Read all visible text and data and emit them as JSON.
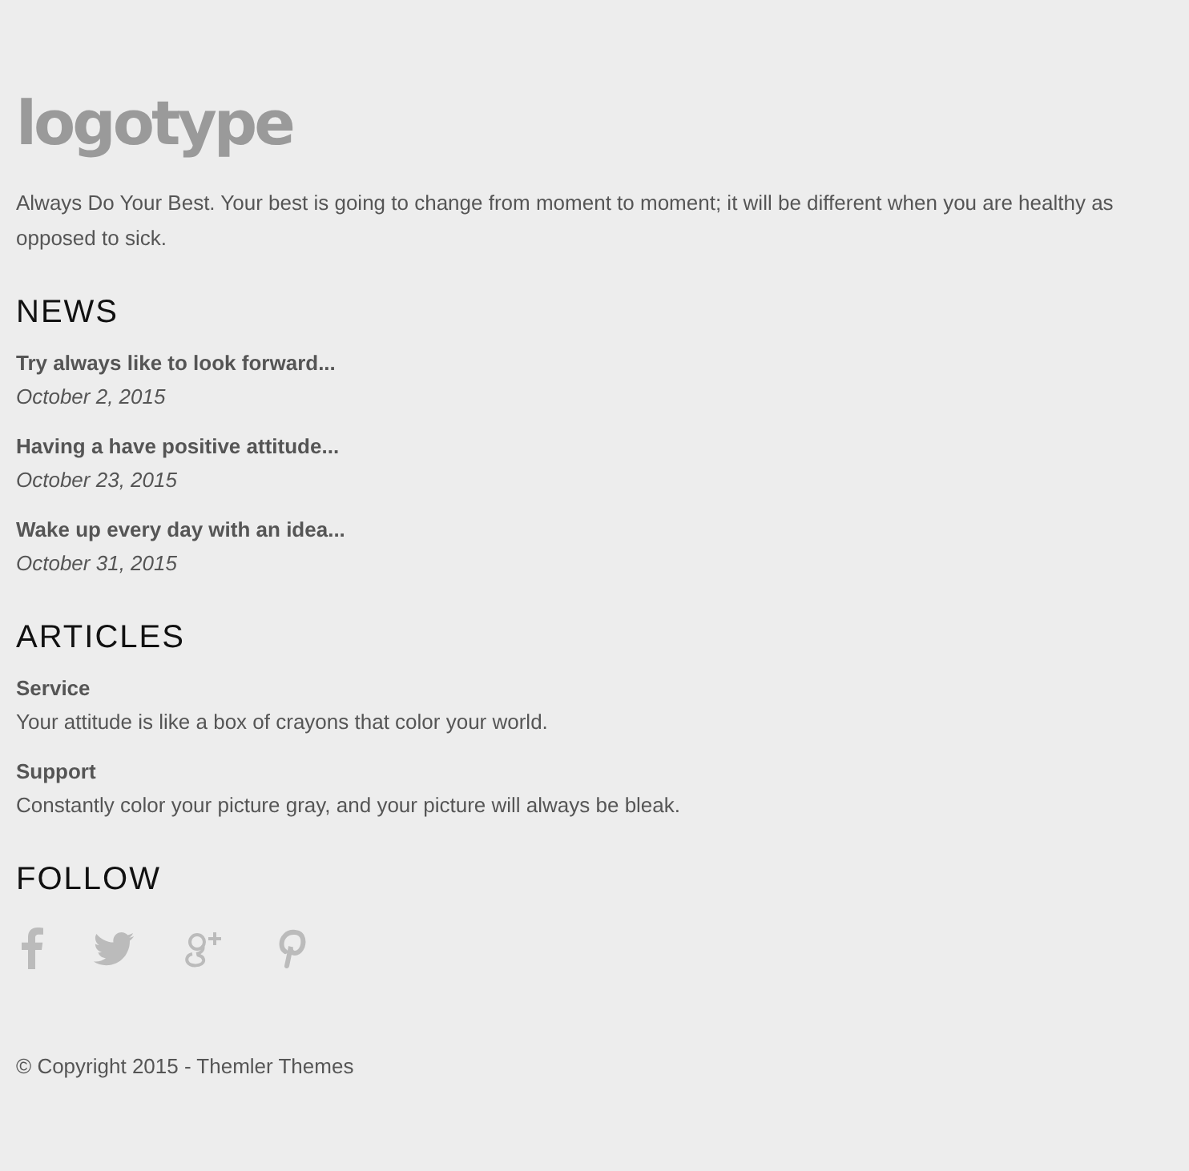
{
  "logo": "logotype",
  "intro": "Always Do Your Best. Your best is going to change from moment to moment; it will be different when you are healthy as opposed to sick.",
  "news": {
    "title": "NEWS",
    "items": [
      {
        "title": "Try always like to look forward...",
        "date": "October 2, 2015"
      },
      {
        "title": "Having a have positive attitude...",
        "date": "October 23, 2015"
      },
      {
        "title": "Wake up every day with an idea...",
        "date": "October 31, 2015"
      }
    ]
  },
  "articles": {
    "title": "ARTICLES",
    "items": [
      {
        "title": "Service",
        "text": "Your attitude is like a box of crayons that color your world."
      },
      {
        "title": "Support",
        "text": "Constantly color your picture gray, and your picture will always be bleak."
      }
    ]
  },
  "follow": {
    "title": "FOLLOW"
  },
  "copyright": "© Copyright 2015 - Themler Themes"
}
